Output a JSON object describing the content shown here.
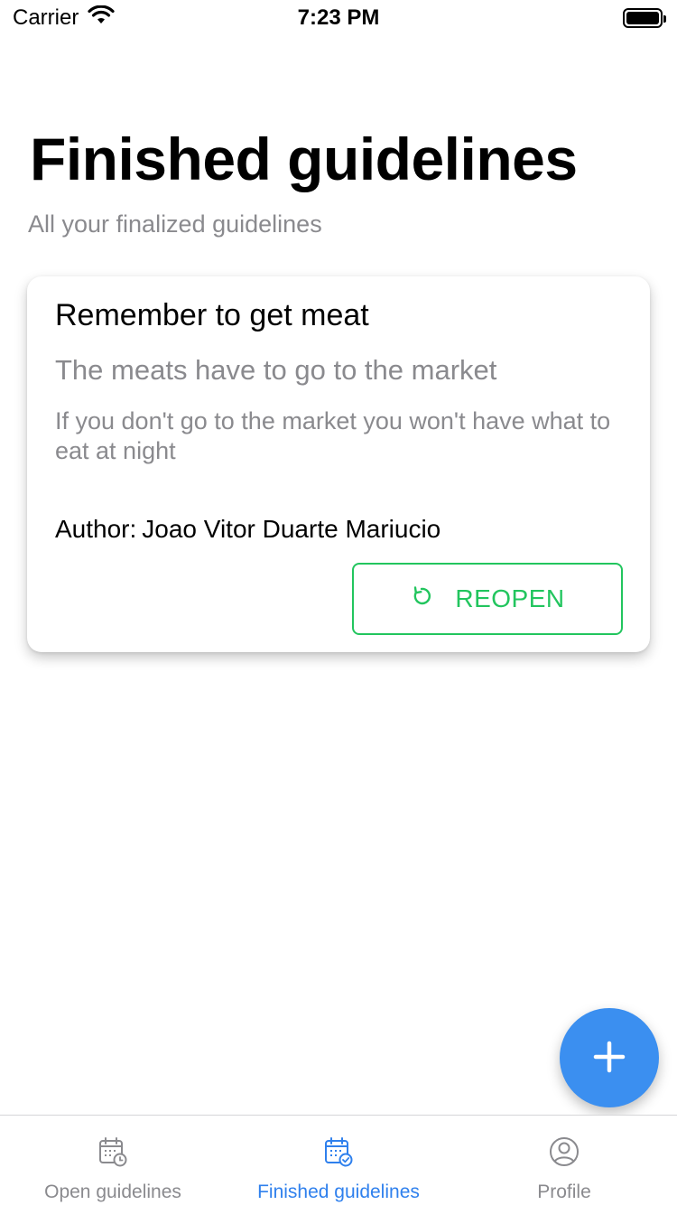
{
  "status_bar": {
    "carrier": "Carrier",
    "time": "7:23 PM"
  },
  "header": {
    "title": "Finished guidelines",
    "subtitle": "All your finalized guidelines"
  },
  "guidelines": [
    {
      "title": "Remember to get meat",
      "description": "The meats have to go to the market",
      "details": "If you don't go to the market you won't have what to eat at night",
      "author_label": "Author:",
      "author": "Joao Vitor Duarte Mariucio",
      "action_label": "REOPEN",
      "action_icon": "reload-icon"
    }
  ],
  "fab": {
    "icon": "plus-icon"
  },
  "tab_bar": {
    "items": [
      {
        "label": "Open guidelines",
        "icon": "calendar-clock-icon",
        "active": false
      },
      {
        "label": "Finished guidelines",
        "icon": "calendar-check-icon",
        "active": true
      },
      {
        "label": "Profile",
        "icon": "user-circle-icon",
        "active": false
      }
    ]
  },
  "colors": {
    "accent_blue": "#2f80ed",
    "fab_blue": "#3b8ff0",
    "reopen_green": "#22c55e",
    "muted_gray": "#8a8a8e"
  }
}
